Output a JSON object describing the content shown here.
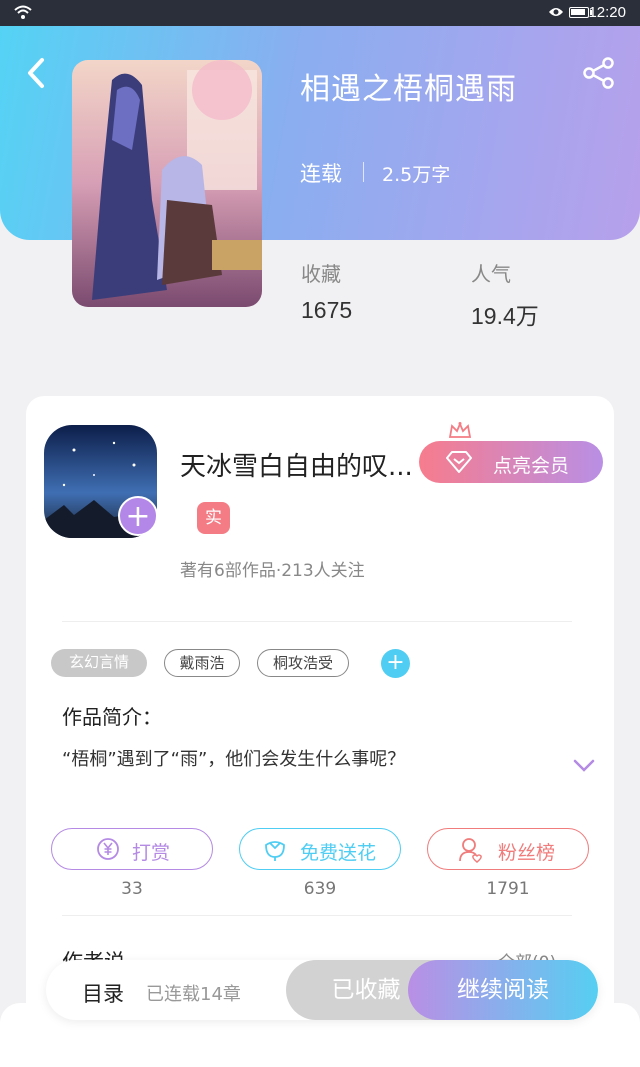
{
  "status_bar": {
    "time": "12:20",
    "battery_level": 0.9
  },
  "book": {
    "title": "相遇之梧桐遇雨",
    "status": "连载",
    "word_count": "2.5万字",
    "stats": [
      {
        "label": "收藏",
        "value": "1675"
      },
      {
        "label": "人气",
        "value": "19.4万"
      }
    ]
  },
  "author": {
    "name": "天冰雪白自由的叹...",
    "badge": "实",
    "meta": "著有6部作品·213人关注",
    "vip_button": "点亮会员"
  },
  "tags": [
    "玄幻言情",
    "戴雨浩",
    "桐攻浩受"
  ],
  "intro": {
    "title": "作品简介：",
    "text": "“梧桐”遇到了“雨”，他们会发生什么事呢？"
  },
  "actions": [
    {
      "label": "打赏",
      "count": "33",
      "icon": "yen-coin-icon",
      "color": "#b48ae4"
    },
    {
      "label": "免费送花",
      "count": "639",
      "icon": "flower-icon",
      "color": "#4fcdf2"
    },
    {
      "label": "粉丝榜",
      "count": "1791",
      "icon": "fan-user-icon",
      "color": "#f07c7c"
    }
  ],
  "author_says": {
    "title": "作者说",
    "all_link": "全部(0)"
  },
  "bottom_bar": {
    "catalog": "目录",
    "chapters": "已连载14章",
    "collected": "已收藏",
    "continue": "继续阅读"
  },
  "colors": {
    "accent_blue": "#4fcdf2",
    "accent_purple": "#b98fe5",
    "accent_pink": "#f77c8d"
  }
}
